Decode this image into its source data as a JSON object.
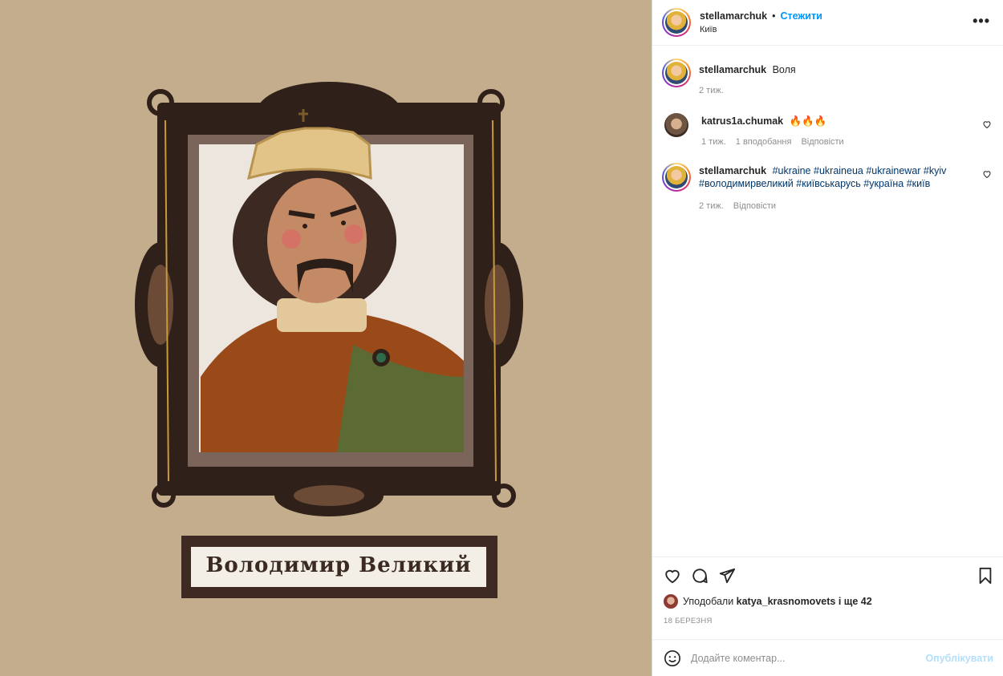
{
  "post": {
    "author": "stellamarchuk",
    "separator": "•",
    "follow_label": "Стежити",
    "location": "Київ",
    "more_label": "•••",
    "image_caption_text": "Володимир Великий"
  },
  "comments": [
    {
      "username": "stellamarchuk",
      "text": "Воля",
      "time": "2 тиж.",
      "likes": "",
      "reply": ""
    },
    {
      "username": "katrus1a.chumak",
      "text": "🔥🔥🔥",
      "time": "1 тиж.",
      "likes": "1 вподобання",
      "reply": "Відповісти"
    },
    {
      "username": "stellamarchuk",
      "hashtags": [
        "#ukraine",
        "#ukraineua",
        "#ukrainewar",
        "#kyiv",
        "#володимирвеликий",
        "#київськарусь",
        "#україна",
        "#київ"
      ],
      "time": "2 тиж.",
      "reply": "Відповісти"
    }
  ],
  "likes": {
    "prefix": "Уподобали",
    "user": "katya_krasnomovets",
    "suffix": "і ще 42"
  },
  "date": "18 БЕРЕЗНЯ",
  "comment_box": {
    "placeholder": "Додайте коментар...",
    "post_label": "Опублікувати"
  },
  "icons": [
    "heart-icon",
    "comment-icon",
    "share-icon",
    "bookmark-icon",
    "emoji-icon",
    "more-icon"
  ],
  "colors": {
    "accent": "#0095f6",
    "hashtag": "#00376b",
    "muted": "#8e8e8e",
    "media_bg": "#c4ad8d"
  }
}
